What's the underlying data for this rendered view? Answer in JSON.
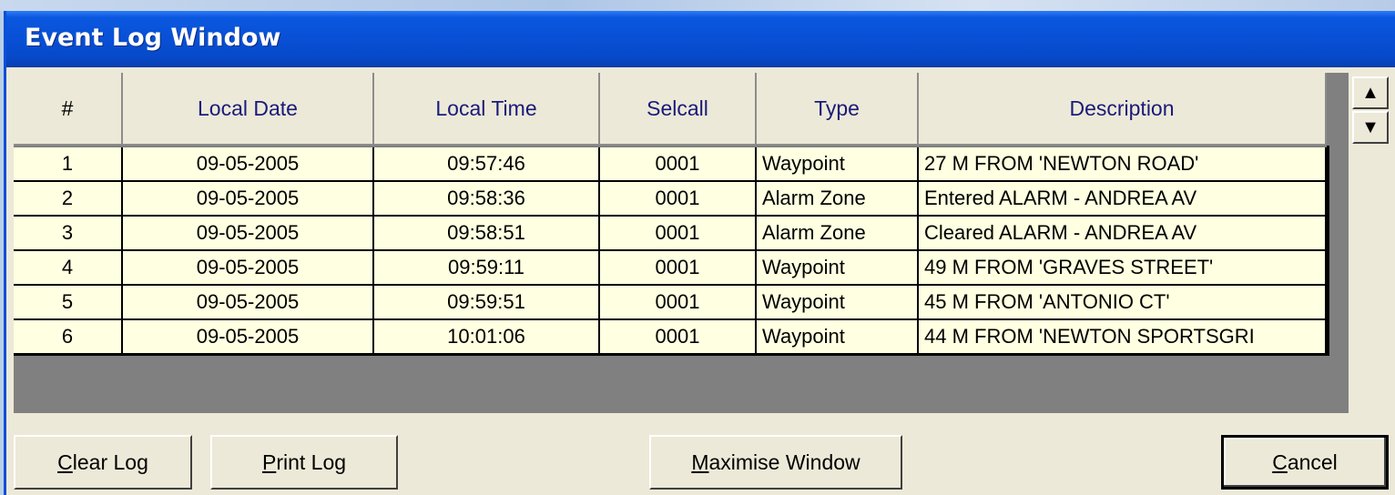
{
  "window": {
    "title": "Event Log Window"
  },
  "table": {
    "headers": [
      "#",
      "Local Date",
      "Local Time",
      "Selcall",
      "Type",
      "Description"
    ],
    "rows": [
      [
        "1",
        "09-05-2005",
        "09:57:46",
        "0001",
        "Waypoint",
        "27 M FROM 'NEWTON ROAD'"
      ],
      [
        "2",
        "09-05-2005",
        "09:58:36",
        "0001",
        "Alarm Zone",
        "Entered ALARM - ANDREA AV"
      ],
      [
        "3",
        "09-05-2005",
        "09:58:51",
        "0001",
        "Alarm Zone",
        "Cleared ALARM - ANDREA AV"
      ],
      [
        "4",
        "09-05-2005",
        "09:59:11",
        "0001",
        "Waypoint",
        "49 M FROM 'GRAVES STREET'"
      ],
      [
        "5",
        "09-05-2005",
        "09:59:51",
        "0001",
        "Waypoint",
        "45 M FROM 'ANTONIO CT'"
      ],
      [
        "6",
        "09-05-2005",
        "10:01:06",
        "0001",
        "Waypoint",
        "44 M FROM 'NEWTON SPORTSGRI"
      ]
    ]
  },
  "scrollbar": {
    "up_icon": "triangle-up-icon",
    "down_icon": "triangle-down-icon"
  },
  "buttons": {
    "clear_log": {
      "mnemonic": "C",
      "rest": "lear Log"
    },
    "print_log": {
      "mnemonic": "P",
      "rest": "rint Log"
    },
    "maximise_window": {
      "mnemonic": "M",
      "rest": "aximise Window"
    },
    "cancel": {
      "mnemonic": "C",
      "rest": "ancel"
    }
  },
  "colors": {
    "titlebar": "#0850d6",
    "window_bg": "#ece9d8",
    "row_bg": "#ffffe1",
    "grid_empty": "#808080"
  }
}
